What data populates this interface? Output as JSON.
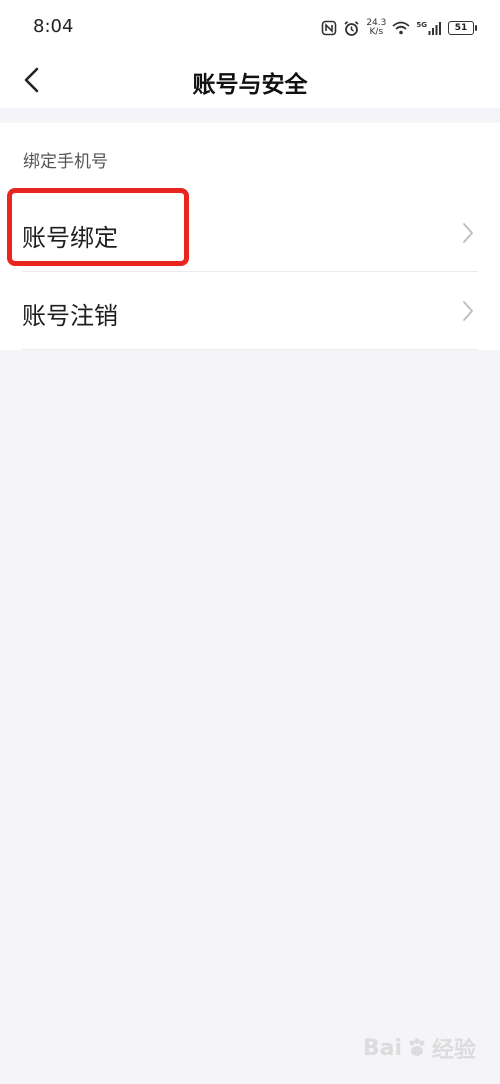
{
  "status_bar": {
    "time": "8:04",
    "net_speed_value": "24.3",
    "net_speed_unit": "K/s",
    "network_type": "5G",
    "battery_level": "51",
    "icons": [
      "nfc-icon",
      "alarm-icon",
      "wifi-icon",
      "signal-icon",
      "battery-icon"
    ]
  },
  "nav": {
    "title": "账号与安全",
    "back_icon": "chevron-left-icon"
  },
  "settings": {
    "section_label": "绑定手机号",
    "items": [
      {
        "label": "账号绑定",
        "icon": "chevron-right-icon",
        "highlighted": true
      },
      {
        "label": "账号注销",
        "icon": "chevron-right-icon",
        "highlighted": false
      }
    ]
  },
  "colors": {
    "page_background": "#f5f4f8",
    "card_background": "#ffffff",
    "highlight_border": "#e8261f",
    "chevron": "#bdbdbd"
  },
  "watermark": {
    "brand": "Bai",
    "suffix": "经验"
  }
}
